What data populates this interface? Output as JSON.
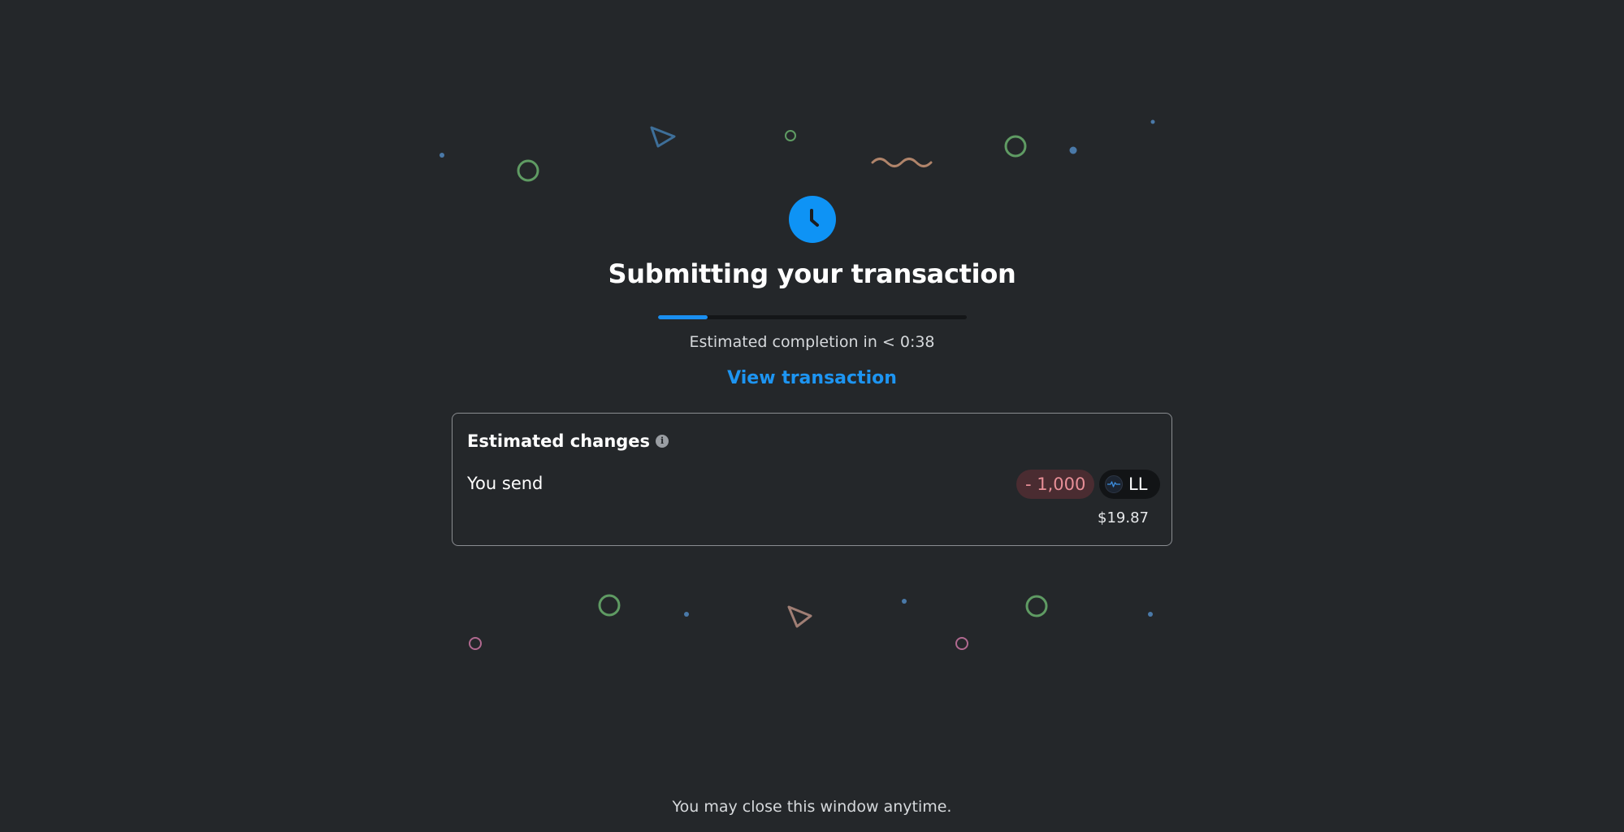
{
  "status": {
    "icon": "clock-icon",
    "title": "Submitting your transaction",
    "progress_fraction": 0.16,
    "eta_text": "Estimated completion in < 0:38",
    "view_link_label": "View transaction"
  },
  "estimated_changes": {
    "heading": "Estimated changes",
    "info_icon": "info-icon",
    "rows": [
      {
        "label": "You send",
        "amount": "- 1,000",
        "token_symbol": "LL",
        "fiat_value": "$19.87"
      }
    ]
  },
  "footer": {
    "note": "You may close this window anytime."
  },
  "colors": {
    "background": "#24272a",
    "accent_blue": "#0e93f5",
    "negative_amount_text": "#e88f97",
    "negative_amount_bg": "#4a2c31"
  }
}
